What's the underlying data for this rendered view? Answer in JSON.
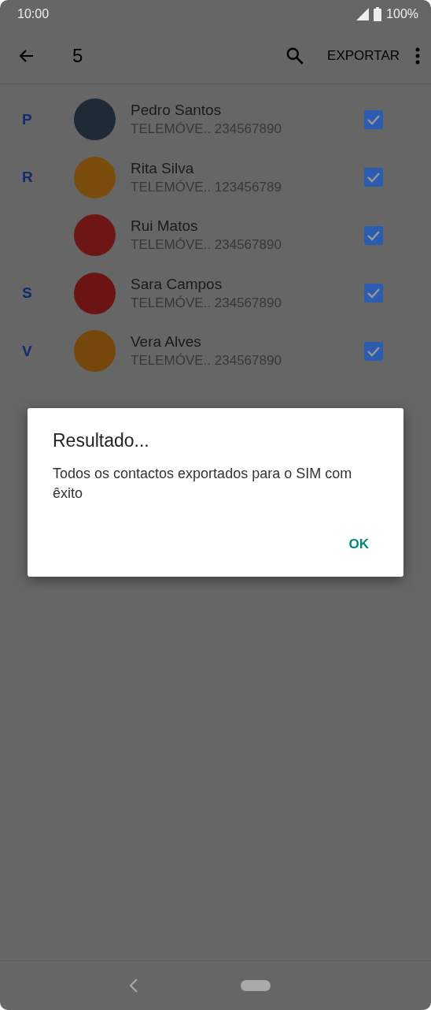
{
  "status_bar": {
    "time": "10:00",
    "battery": "100%"
  },
  "toolbar": {
    "count": "5",
    "action": "EXPORTAR"
  },
  "contacts": [
    {
      "section": "P",
      "name": "Pedro Santos",
      "type": "TELEMÓVE..",
      "number": "234567890",
      "color": "#1f2a36",
      "checked": true
    },
    {
      "section": "R",
      "name": "Rita Silva",
      "type": "TELEMÓVE..",
      "number": "123456789",
      "color": "#7a4d0c",
      "checked": true
    },
    {
      "name": "Rui Matos",
      "type": "TELEMÓVE..",
      "number": "234567890",
      "color": "#6e1515",
      "checked": true
    },
    {
      "section": "S",
      "name": "Sara Campos",
      "type": "TELEMÓVE..",
      "number": "234567890",
      "color": "#6a1414",
      "checked": true
    },
    {
      "section": "V",
      "name": "Vera Alves",
      "type": "TELEMÓVE..",
      "number": "234567890",
      "color": "#75470a",
      "checked": true
    }
  ],
  "dialog": {
    "title": "Resultado...",
    "message": "Todos os contactos exportados para o SIM com êxito",
    "button": "OK"
  }
}
